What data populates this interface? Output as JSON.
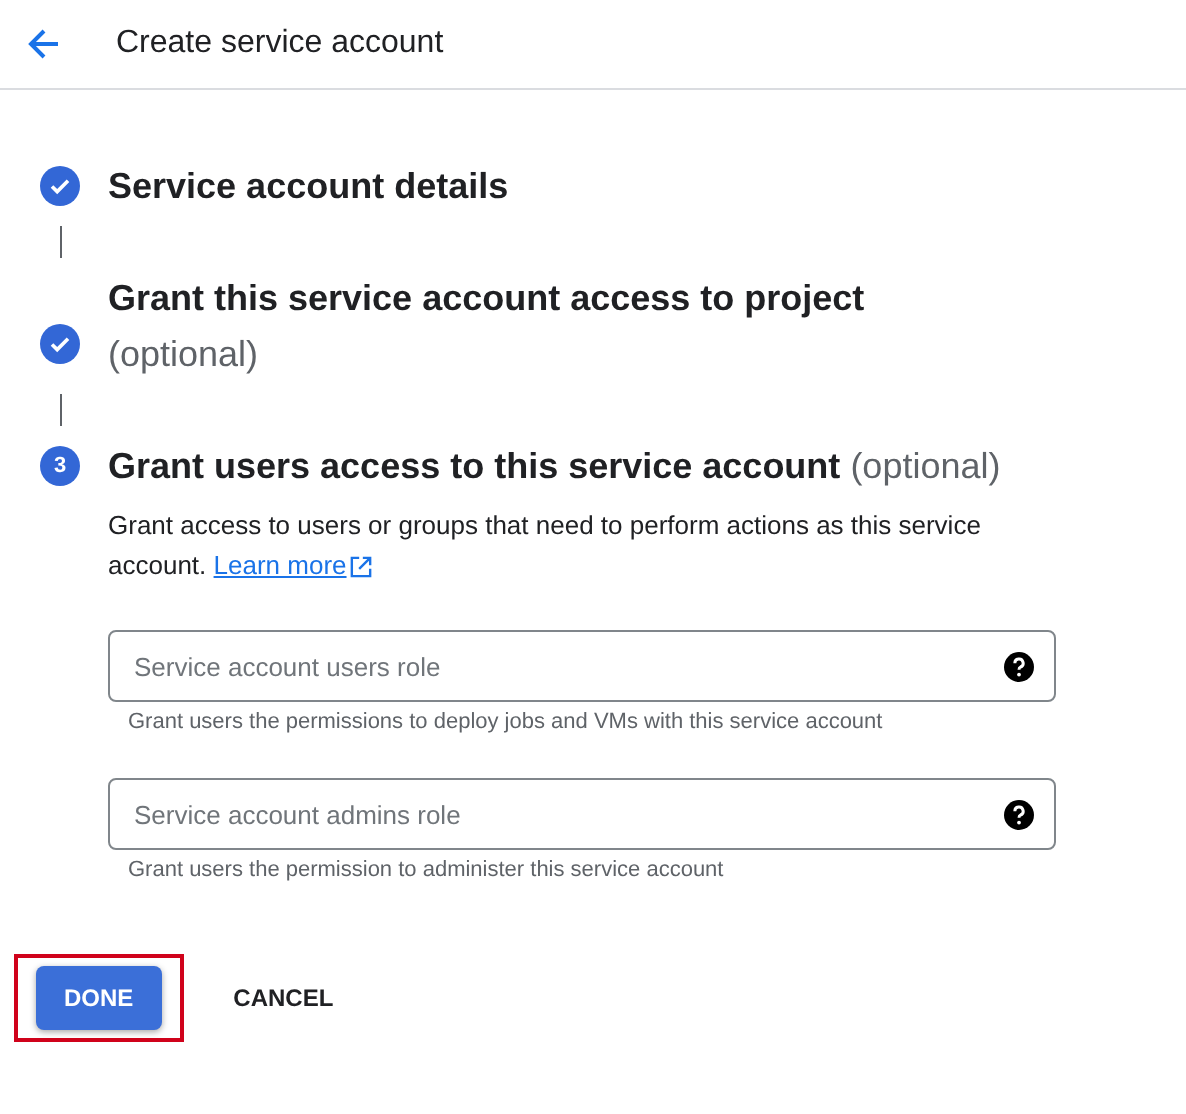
{
  "header": {
    "title": "Create service account"
  },
  "steps": [
    {
      "kind": "done",
      "title": "Service account details"
    },
    {
      "kind": "done",
      "title": "Grant this service account access to project",
      "optional": "(optional)",
      "optional_wraps": true
    },
    {
      "kind": "current",
      "number": "3",
      "title": "Grant users access to this service account",
      "optional": "(optional)",
      "optional_wraps": false,
      "description": "Grant access to users or groups that need to perform actions as this service account.",
      "link": "Learn more",
      "fields": [
        {
          "placeholder": "Service account users role",
          "hint": "Grant users the permissions to deploy jobs and VMs with this service account"
        },
        {
          "placeholder": "Service account admins role",
          "hint": "Grant users the permission to administer this service account"
        }
      ]
    }
  ],
  "actions": [
    {
      "kind": "primary",
      "label": "DONE",
      "highlighted": true
    },
    {
      "kind": "text",
      "label": "CANCEL",
      "highlighted": false
    }
  ]
}
